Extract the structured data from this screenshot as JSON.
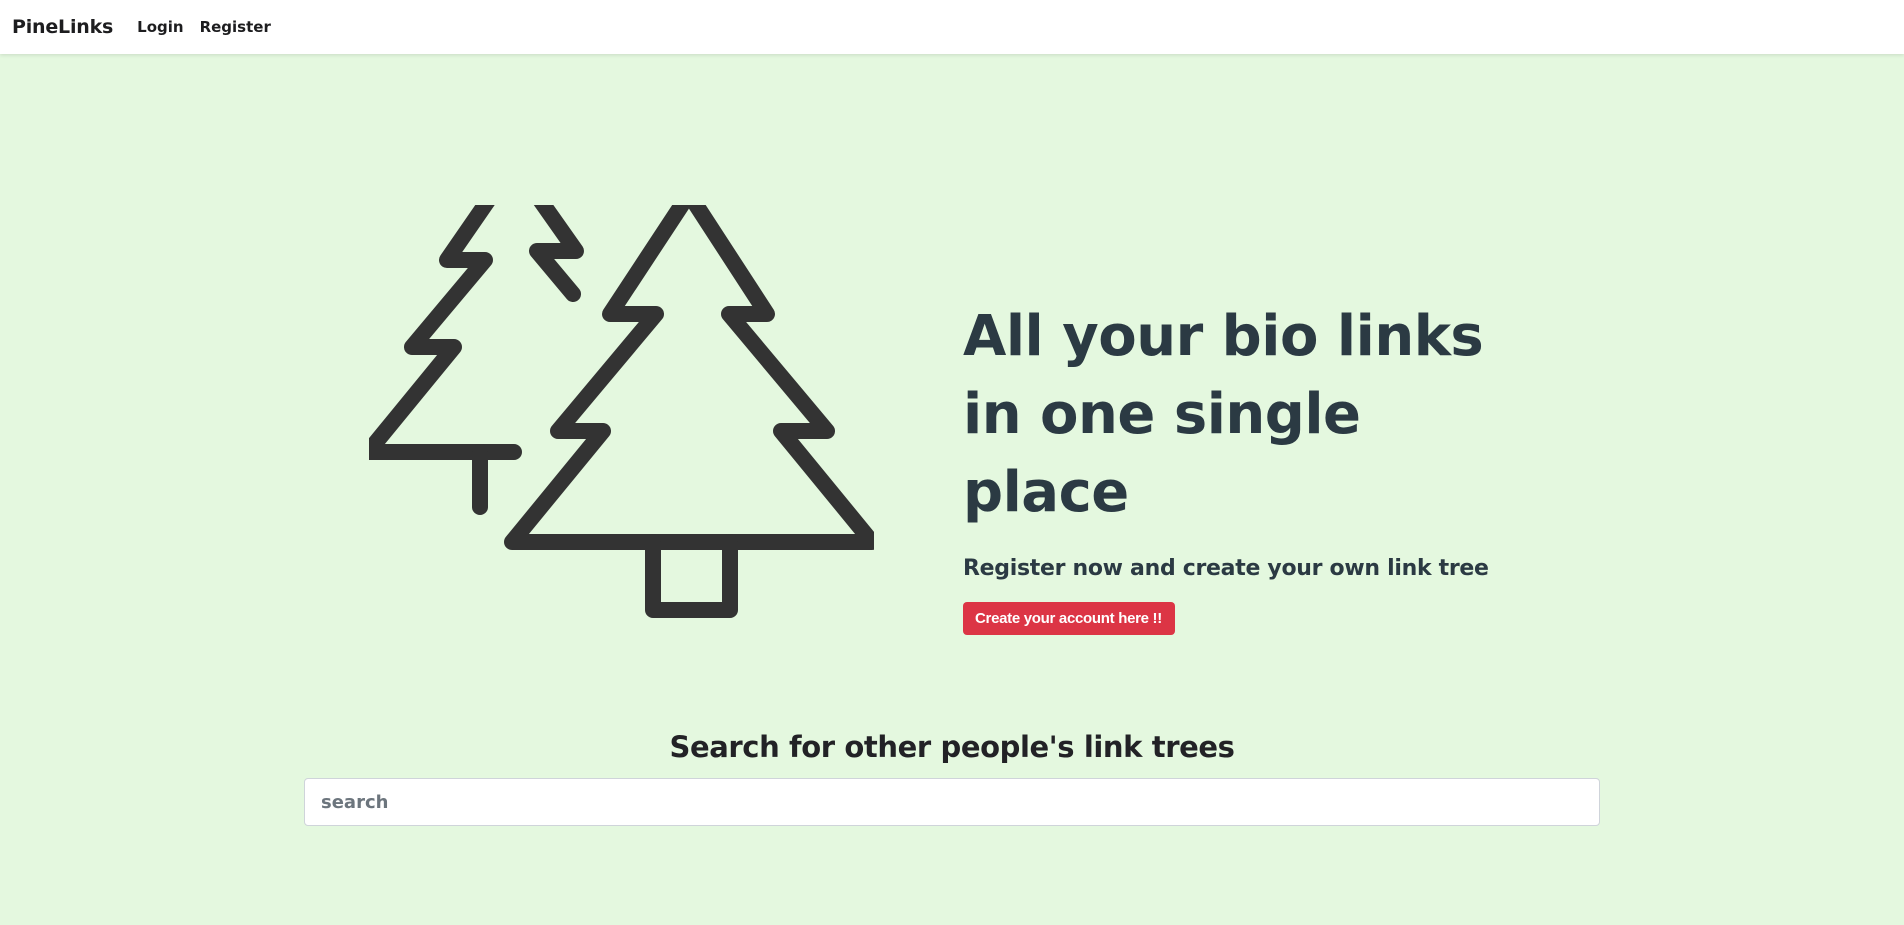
{
  "navbar": {
    "brand": "PineLinks",
    "links": [
      {
        "label": "Login"
      },
      {
        "label": "Register"
      }
    ]
  },
  "hero": {
    "illustration_icon": "pine-trees-icon",
    "title_line1": "All your bio links",
    "title_line2": "in one single",
    "title_line3": "place",
    "subtitle": "Register now and create your own link tree",
    "cta_label": "Create your account here !!"
  },
  "search": {
    "title": "Search for other people's link trees",
    "placeholder": "search",
    "value": ""
  },
  "colors": {
    "background": "#e4f8df",
    "navbar": "#ffffff",
    "heading": "#2b3a43",
    "cta": "#dc3545",
    "icon_stroke": "#333333"
  }
}
